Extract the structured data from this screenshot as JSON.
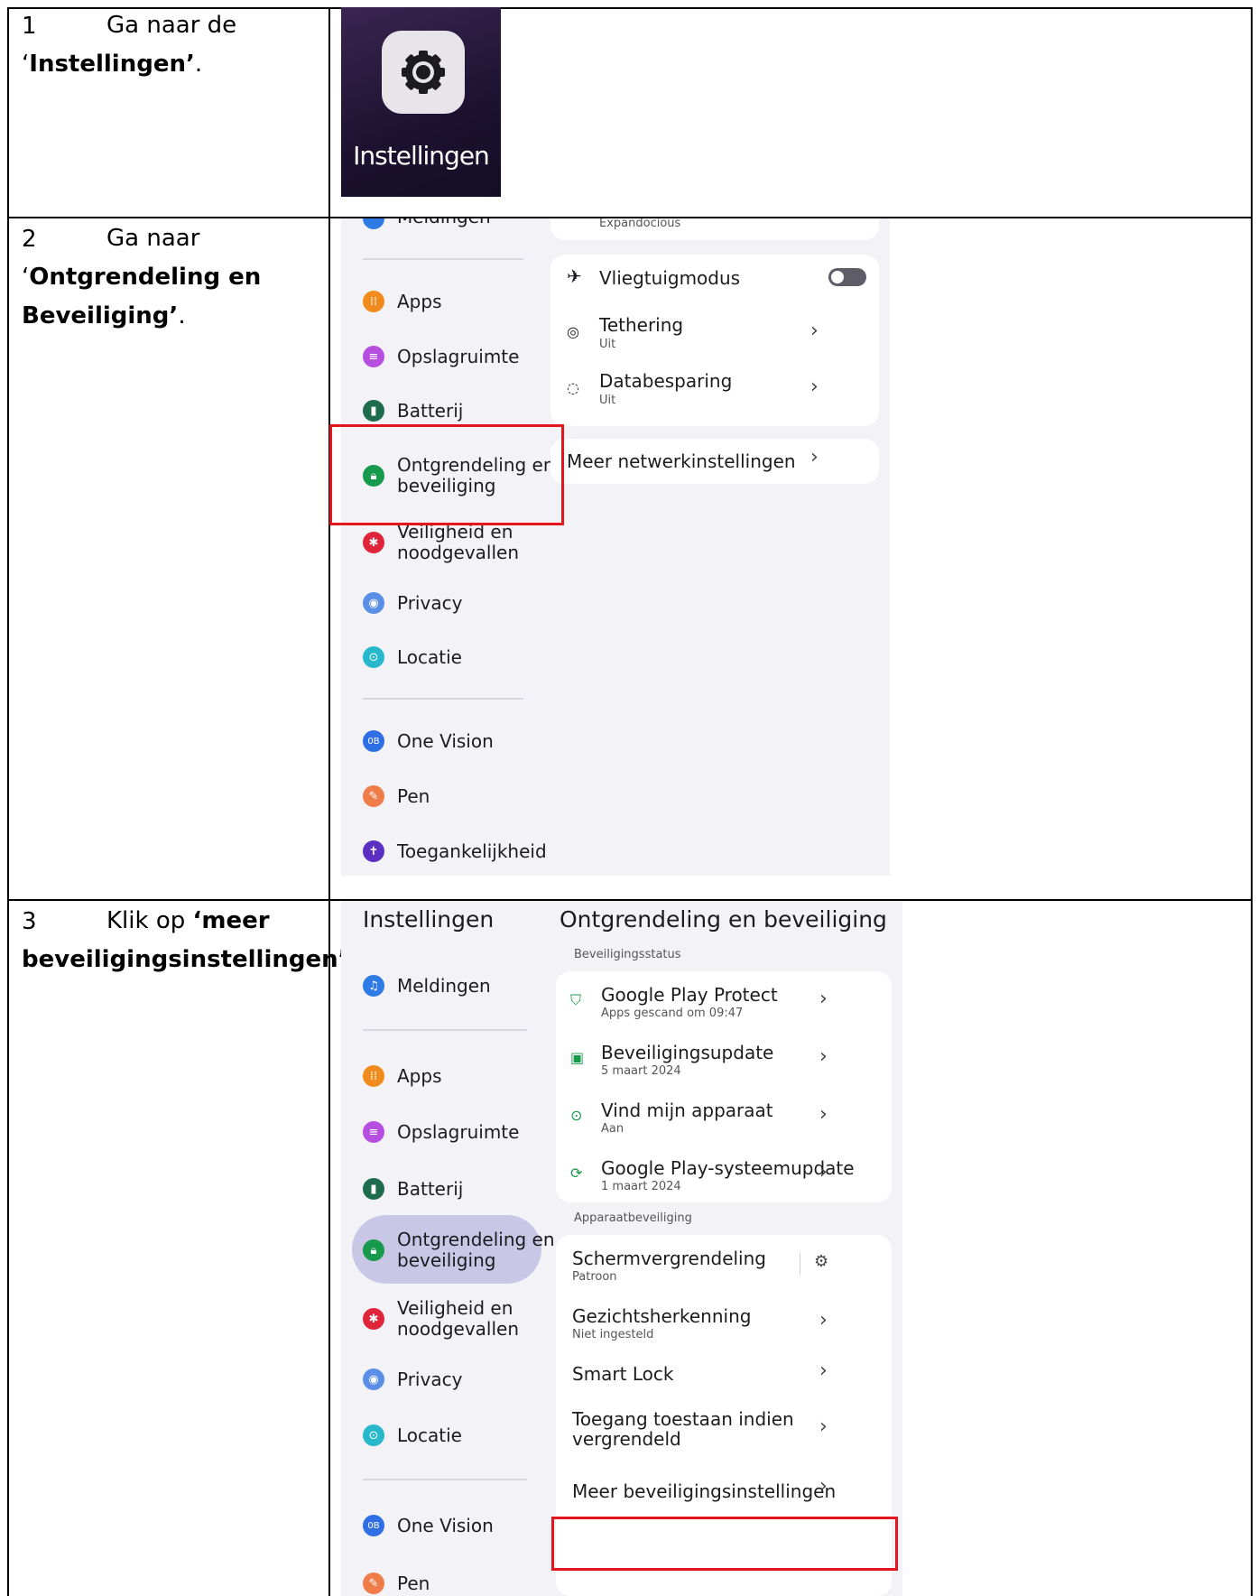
{
  "steps": [
    {
      "number": "1",
      "pre": "Ga naar de",
      "open": "‘",
      "bold": "Instellingen’",
      "post": "."
    },
    {
      "number": "2",
      "pre": "Ga naar",
      "open": "‘",
      "bold1": "Ontgrendeling en",
      "bold2": "Beveiliging",
      "close": "’",
      "post": "."
    },
    {
      "number": "3",
      "pre": "Klik op ",
      "bold1": "‘meer",
      "bold2": "beveiligingsinstellingen",
      "close": "’",
      "post": "."
    }
  ],
  "app_icon": {
    "label": "Instellingen",
    "icon": "gear-icon"
  },
  "shot2": {
    "top_partial": "Meldingen",
    "top_right_partial": "Expandocious",
    "sidebar": [
      {
        "label": "Apps",
        "icon": "apps-icon",
        "color": "#f28b1e"
      },
      {
        "label": "Opslagruimte",
        "icon": "storage-icon",
        "color": "#b64ee0"
      },
      {
        "label": "Batterij",
        "icon": "battery-icon",
        "color": "#1f6b4e"
      },
      {
        "label": "Ontgrendeling en",
        "label2": "beveiliging",
        "icon": "lock-icon",
        "color": "#189a4c"
      },
      {
        "label": "Veiligheid en",
        "label2": "noodgevallen",
        "icon": "emergency-icon",
        "color": "#e0253b"
      },
      {
        "label": "Privacy",
        "icon": "privacy-icon",
        "color": "#5b8ee6"
      },
      {
        "label": "Locatie",
        "icon": "location-icon",
        "color": "#28b8cc"
      },
      {
        "label": "One Vision",
        "icon": "one-vision-icon",
        "color": "#2f6fe6"
      },
      {
        "label": "Pen",
        "icon": "pen-icon",
        "color": "#f07c4a"
      },
      {
        "label": "Toegankelijkheid",
        "icon": "accessibility-icon",
        "color": "#5a2fc2"
      }
    ],
    "network": [
      {
        "title": "Vliegtuigmodus",
        "icon": "airplane-icon",
        "toggle": "off"
      },
      {
        "title": "Tethering",
        "sub": "Uit",
        "icon": "hotspot-icon"
      },
      {
        "title": "Databesparing",
        "sub": "Uit",
        "icon": "data-saver-icon"
      }
    ],
    "more_network": "Meer netwerkinstellingen"
  },
  "shot3": {
    "left_title": "Instellingen",
    "right_title": "Ontgrendeling en beveiliging",
    "sidebar": [
      {
        "label": "Meldingen",
        "icon": "bell-icon",
        "color": "#2f7be6"
      },
      {
        "label": "Apps",
        "icon": "apps-icon",
        "color": "#f28b1e"
      },
      {
        "label": "Opslagruimte",
        "icon": "storage-icon",
        "color": "#b64ee0"
      },
      {
        "label": "Batterij",
        "icon": "battery-icon",
        "color": "#1f6b4e"
      },
      {
        "label": "Ontgrendeling en",
        "label2": "beveiliging",
        "icon": "lock-icon",
        "color": "#189a4c"
      },
      {
        "label": "Veiligheid en",
        "label2": "noodgevallen",
        "icon": "emergency-icon",
        "color": "#e0253b"
      },
      {
        "label": "Privacy",
        "icon": "privacy-icon",
        "color": "#5b8ee6"
      },
      {
        "label": "Locatie",
        "icon": "location-icon",
        "color": "#28b8cc"
      },
      {
        "label": "One Vision",
        "icon": "one-vision-icon",
        "color": "#2f6fe6"
      },
      {
        "label": "Pen",
        "icon": "pen-icon",
        "color": "#f07c4a"
      }
    ],
    "section1": "Beveiligingsstatus",
    "status": [
      {
        "title": "Google Play Protect",
        "sub": "Apps gescand om 09:47",
        "icon": "shield-check-icon"
      },
      {
        "title": "Beveiligingsupdate",
        "sub": "5 maart 2024",
        "icon": "update-icon"
      },
      {
        "title": "Vind mijn apparaat",
        "sub": "Aan",
        "icon": "find-device-icon"
      },
      {
        "title": "Google Play-systeemupdate",
        "sub": "1 maart 2024",
        "icon": "system-update-icon"
      }
    ],
    "section2": "Apparaatbeveiliging",
    "device": [
      {
        "title": "Schermvergrendeling",
        "sub": "Patroon"
      },
      {
        "title": "Gezichtsherkenning",
        "sub": "Niet ingesteld"
      },
      {
        "title": "Smart Lock"
      },
      {
        "title": "Toegang toestaan indien",
        "title2": "vergrendeld"
      },
      {
        "title": "Meer beveiligingsinstellingen"
      }
    ]
  },
  "colors": {
    "highlight": "#e3161d",
    "selected_pill": "#c9c7e6",
    "accent_green": "#189a4c"
  }
}
